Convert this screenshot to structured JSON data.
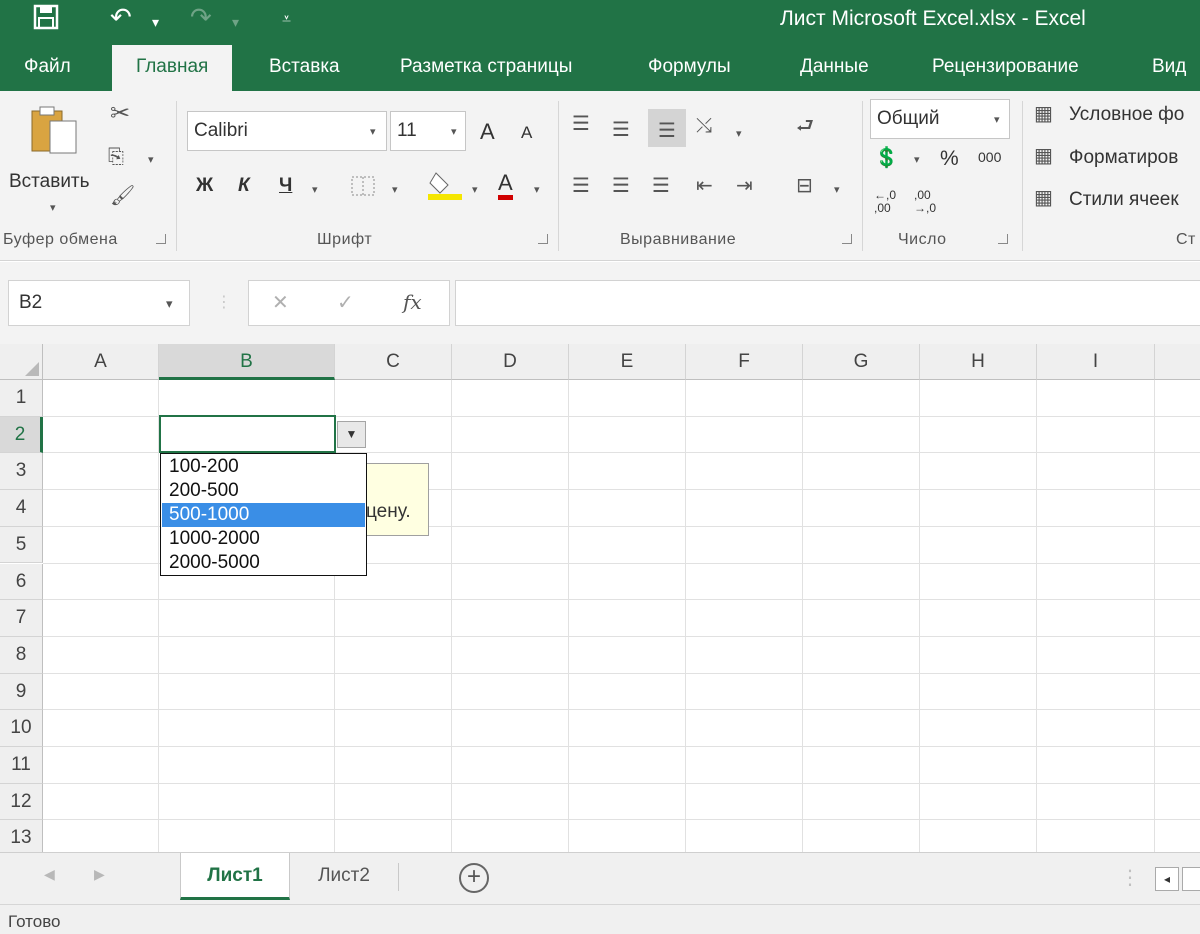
{
  "window": {
    "title": "Лист Microsoft Excel.xlsx - Excel"
  },
  "quick_access": {
    "save_icon": "save-icon",
    "undo_icon": "undo-icon",
    "redo_icon": "redo-icon",
    "customize_icon": "customize-icon"
  },
  "tabs": [
    {
      "label": "Файл"
    },
    {
      "label": "Главная",
      "active": true
    },
    {
      "label": "Вставка"
    },
    {
      "label": "Разметка страницы"
    },
    {
      "label": "Формулы"
    },
    {
      "label": "Данные"
    },
    {
      "label": "Рецензирование"
    },
    {
      "label": "Вид"
    }
  ],
  "ribbon": {
    "clipboard": {
      "label": "Буфер обмена",
      "paste_label": "Вставить"
    },
    "font": {
      "label": "Шрифт",
      "font_name": "Calibri",
      "font_size": "11",
      "bold": "Ж",
      "italic": "К",
      "underline": "Ч",
      "font_color_letter": "А",
      "grow": "A",
      "shrink": "A"
    },
    "alignment": {
      "label": "Выравнивание"
    },
    "number": {
      "label": "Число",
      "format": "Общий",
      "percent": "%",
      "thousands": "000",
      "inc_decimal": "←,0 ,00",
      "dec_decimal": ",00 →,0"
    },
    "styles": {
      "label": "Ст",
      "conditional": "Условное фо",
      "format_table": "Форматиров",
      "cell_styles": "Стили ячеек"
    }
  },
  "formula_bar": {
    "name_box": "B2",
    "cancel": "✕",
    "enter": "✓",
    "fx": "fx",
    "value": ""
  },
  "grid": {
    "columns": [
      "A",
      "B",
      "C",
      "D",
      "E",
      "F",
      "G",
      "H",
      "I"
    ],
    "rows": [
      "1",
      "2",
      "3",
      "4",
      "5",
      "6",
      "7",
      "8",
      "9",
      "10",
      "11",
      "12",
      "13"
    ],
    "selected_column": "B",
    "selected_row": "2",
    "tooltip_text": "цену."
  },
  "dropdown": {
    "items": [
      "100-200",
      "200-500",
      "500-1000",
      "1000-2000",
      "2000-5000"
    ],
    "highlighted": "500-1000"
  },
  "sheets": [
    {
      "label": "Лист1",
      "active": true
    },
    {
      "label": "Лист2",
      "active": false
    }
  ],
  "status": {
    "text": "Готово"
  }
}
